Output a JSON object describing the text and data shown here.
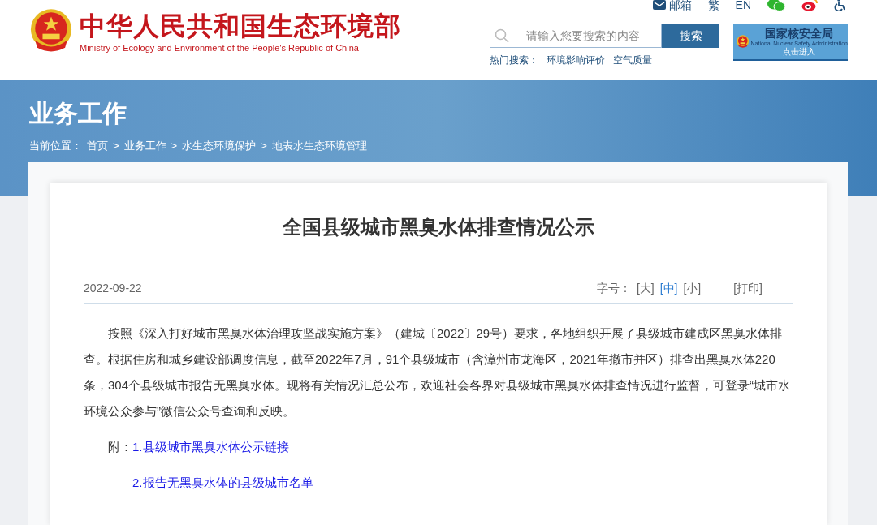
{
  "header": {
    "logo": {
      "title": "中华人民共和国生态环境部",
      "subtitle": "Ministry of Ecology and Environment of the People's Republic of China"
    },
    "top_links": [
      {
        "kind": "mail",
        "label": "邮箱"
      },
      {
        "kind": "text",
        "label": "繁"
      },
      {
        "kind": "text",
        "label": "EN"
      },
      {
        "kind": "wechat"
      },
      {
        "kind": "weibo"
      },
      {
        "kind": "accessibility"
      }
    ],
    "search": {
      "placeholder": "请输入您要搜索的内容",
      "button": "搜索"
    },
    "hot_search": {
      "label": "热门搜索：",
      "items": [
        "环境影响评价",
        "空气质量"
      ]
    },
    "nsa_banner": {
      "title": "国家核安全局",
      "subtitle": "National Nuclear Safety Administration",
      "action": "点击进入"
    }
  },
  "banner": {
    "heading": "业务工作",
    "breadcrumb_label": "当前位置：",
    "separator": ">",
    "breadcrumb": [
      "首页",
      "业务工作",
      "水生态环境保护",
      "地表水生态环境管理"
    ]
  },
  "article": {
    "title": "全国县级城市黑臭水体排查情况公示",
    "date": "2022-09-22",
    "font_size": {
      "label": "字号：",
      "options": [
        {
          "label": "[大]",
          "selected": false
        },
        {
          "label": "[中]",
          "selected": true
        },
        {
          "label": "[小]",
          "selected": false
        }
      ]
    },
    "print": "[打印]",
    "paragraphs": [
      "按照《深入打好城市黑臭水体治理攻坚战实施方案》（建城〔2022〕29号）要求，各地组织开展了县级城市建成区黑臭水体排查。根据住房和城乡建设部调度信息，截至2022年7月，91个县级城市（含漳州市龙海区，2021年撤市并区）排查出黑臭水体220条，304个县级城市报告无黑臭水体。现将有关情况汇总公布，欢迎社会各界对县级城市黑臭水体排查情况进行监督，可登录“城市水环境公众参与”微信公众号查询和反映。"
    ],
    "attachments": {
      "label": "附：",
      "links": [
        "1.县级城市黑臭水体公示链接",
        "2.报告无黑臭水体的县级城市名单"
      ]
    }
  }
}
